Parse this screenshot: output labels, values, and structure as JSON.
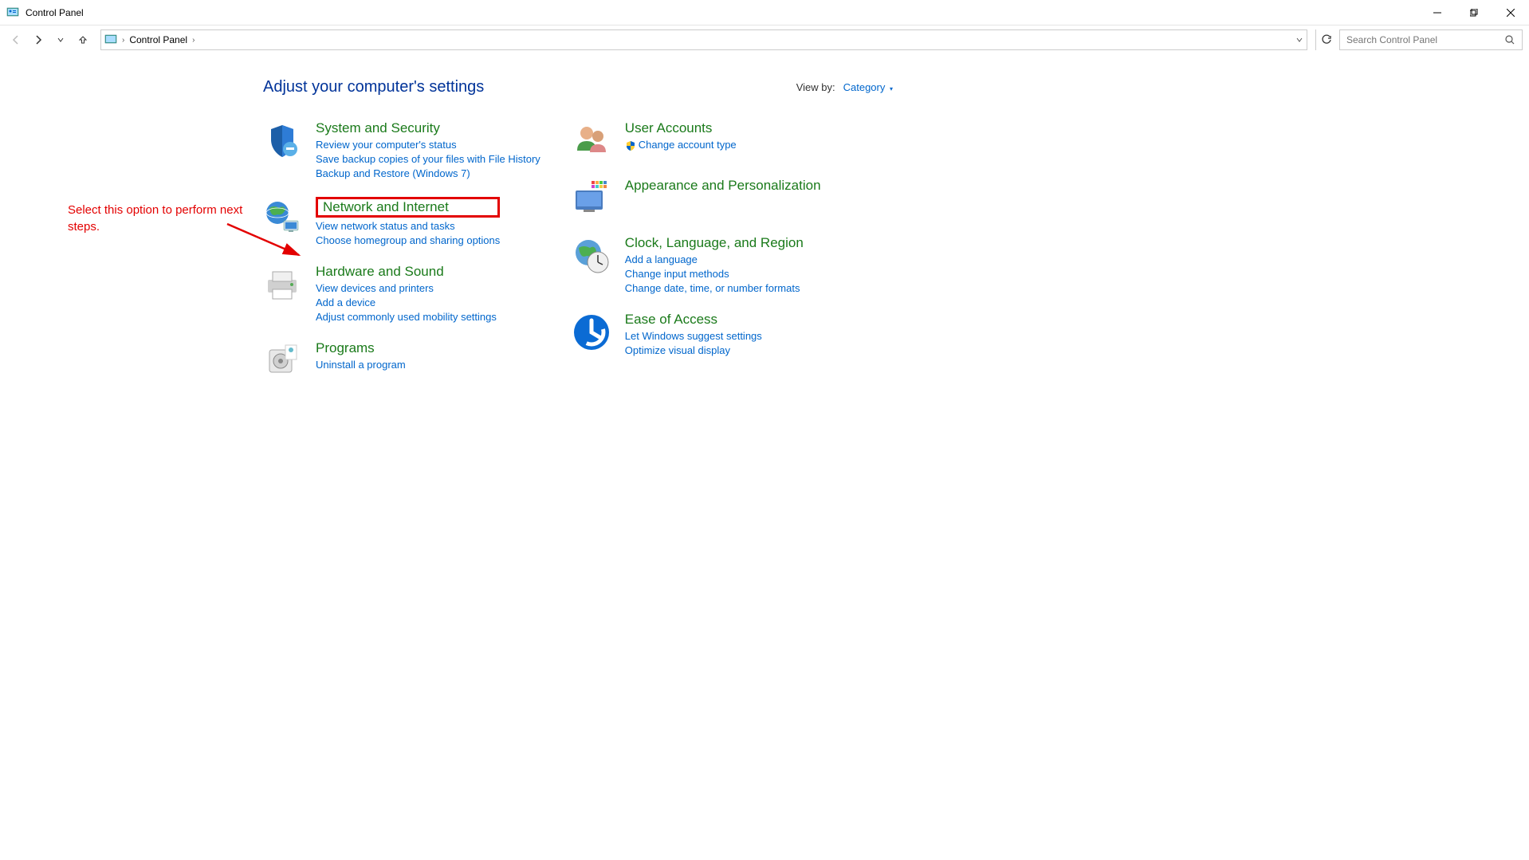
{
  "window": {
    "title": "Control Panel"
  },
  "breadcrumb": {
    "current": "Control Panel"
  },
  "search": {
    "placeholder": "Search Control Panel"
  },
  "header": {
    "title": "Adjust your computer's settings",
    "view_by_label": "View by:",
    "view_by_value": "Category"
  },
  "annotation": {
    "text": "Select this option to perform next steps."
  },
  "left_col": [
    {
      "title": "System and Security",
      "links": [
        "Review your computer's status",
        "Save backup copies of your files with File History",
        "Backup and Restore (Windows 7)"
      ]
    },
    {
      "title": "Network and Internet",
      "highlighted": true,
      "links": [
        "View network status and tasks",
        "Choose homegroup and sharing options"
      ]
    },
    {
      "title": "Hardware and Sound",
      "links": [
        "View devices and printers",
        "Add a device",
        "Adjust commonly used mobility settings"
      ]
    },
    {
      "title": "Programs",
      "links": [
        "Uninstall a program"
      ]
    }
  ],
  "right_col": [
    {
      "title": "User Accounts",
      "links": [
        {
          "text": "Change account type",
          "shield": true
        }
      ]
    },
    {
      "title": "Appearance and Personalization",
      "links": []
    },
    {
      "title": "Clock, Language, and Region",
      "links": [
        "Add a language",
        "Change input methods",
        "Change date, time, or number formats"
      ]
    },
    {
      "title": "Ease of Access",
      "links": [
        "Let Windows suggest settings",
        "Optimize visual display"
      ]
    }
  ]
}
